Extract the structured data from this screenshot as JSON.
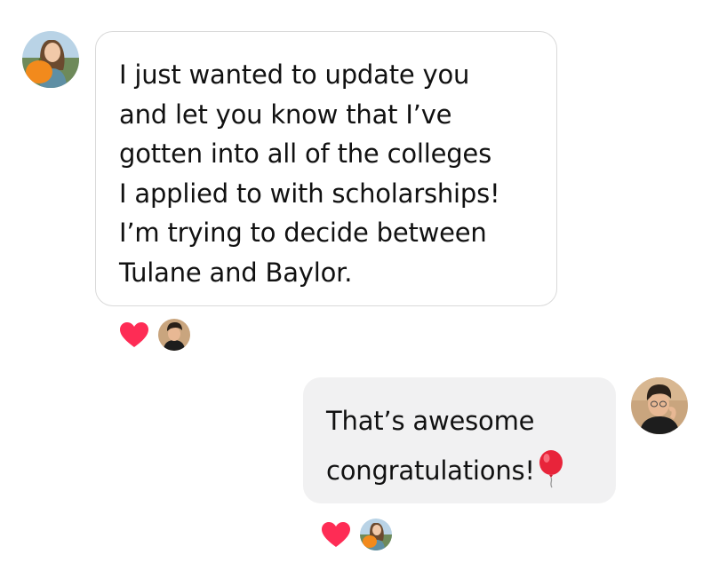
{
  "conversation": {
    "messages": [
      {
        "direction": "incoming",
        "sender_avatar": "avatar-woman-with-pumpkin",
        "text": "I just wanted to update you\nand let you know that I’ve\ngotten into all of the colleges\nI applied to with scholarships!\nI’m trying to decide between\nTulane and Baylor.",
        "reaction": {
          "icon": "heart-icon",
          "color": "#fe2c55",
          "reactor_avatar": "avatar-man"
        }
      },
      {
        "direction": "outgoing",
        "sender_avatar": "avatar-man",
        "text": "That’s awesome\ncongratulations!",
        "emoji": "balloon-icon",
        "reaction": {
          "icon": "heart-icon",
          "color": "#fe2c55",
          "reactor_avatar": "avatar-woman-with-pumpkin"
        }
      }
    ]
  },
  "colors": {
    "incoming_bubble_border": "#d9d9d9",
    "outgoing_bubble_bg": "#f1f1f2",
    "heart": "#fe2c55",
    "balloon": "#e8243a"
  }
}
